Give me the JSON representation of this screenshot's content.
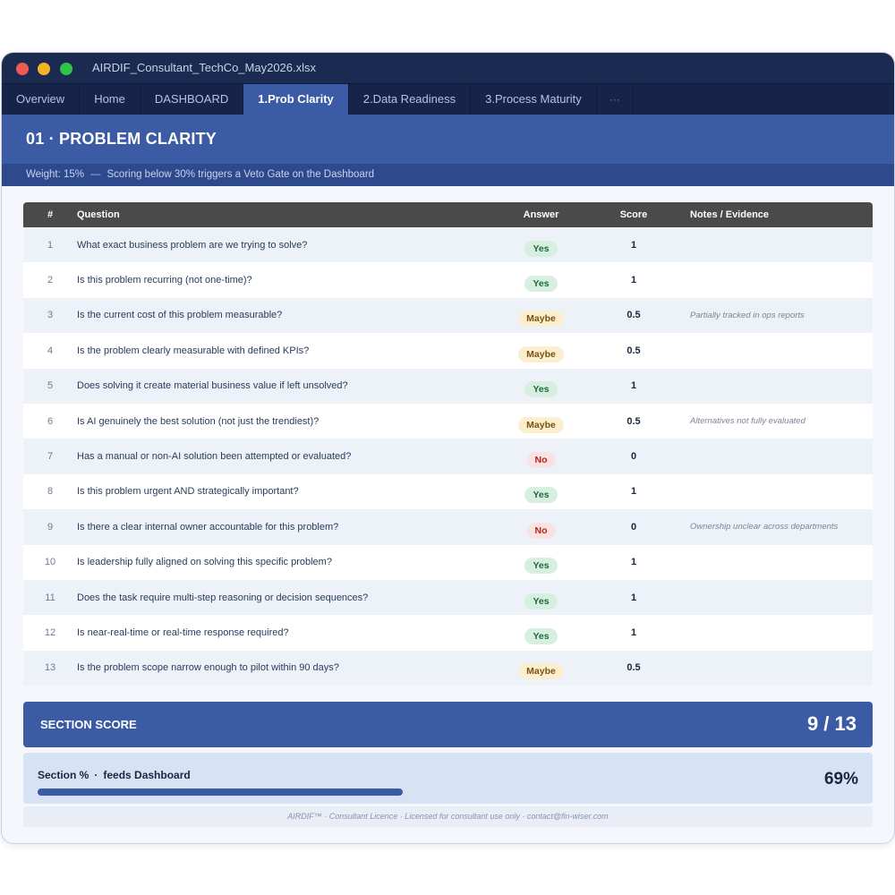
{
  "window": {
    "title": "AIRDIF_Consultant_TechCo_May2026.xlsx"
  },
  "tabs": [
    {
      "label": "Overview",
      "active": false
    },
    {
      "label": "Home",
      "active": false
    },
    {
      "label": "DASHBOARD",
      "active": false
    },
    {
      "label": "1.Prob Clarity",
      "active": true
    },
    {
      "label": "2.Data Readiness",
      "active": false
    },
    {
      "label": "3.Process Maturity",
      "active": false
    },
    {
      "label": "···",
      "active": false
    }
  ],
  "section": {
    "title": "01 · PROBLEM CLARITY",
    "weight": "Weight: 15%",
    "dash": "—",
    "weight_note": "Scoring below 30% triggers a Veto Gate on the Dashboard"
  },
  "table": {
    "headers": {
      "num": "#",
      "question": "Question",
      "answer": "Answer",
      "score": "Score",
      "notes": "Notes / Evidence"
    },
    "rows": [
      {
        "num": "1",
        "question": "What exact business problem are we trying to solve?",
        "answer": "Yes",
        "score": "1",
        "notes": ""
      },
      {
        "num": "2",
        "question": "Is this problem recurring (not one-time)?",
        "answer": "Yes",
        "score": "1",
        "notes": ""
      },
      {
        "num": "3",
        "question": "Is the current cost of this problem measurable?",
        "answer": "Maybe",
        "score": "0.5",
        "notes": "Partially tracked in ops reports"
      },
      {
        "num": "4",
        "question": "Is the problem clearly measurable with defined KPIs?",
        "answer": "Maybe",
        "score": "0.5",
        "notes": ""
      },
      {
        "num": "5",
        "question": "Does solving it create material business value if left unsolved?",
        "answer": "Yes",
        "score": "1",
        "notes": ""
      },
      {
        "num": "6",
        "question": "Is AI genuinely the best solution (not just the trendiest)?",
        "answer": "Maybe",
        "score": "0.5",
        "notes": "Alternatives not fully evaluated"
      },
      {
        "num": "7",
        "question": "Has a manual or non-AI solution been attempted or evaluated?",
        "answer": "No",
        "score": "0",
        "notes": ""
      },
      {
        "num": "8",
        "question": "Is this problem urgent AND strategically important?",
        "answer": "Yes",
        "score": "1",
        "notes": ""
      },
      {
        "num": "9",
        "question": "Is there a clear internal owner accountable for this problem?",
        "answer": "No",
        "score": "0",
        "notes": "Ownership unclear across departments"
      },
      {
        "num": "10",
        "question": "Is leadership fully aligned on solving this specific problem?",
        "answer": "Yes",
        "score": "1",
        "notes": ""
      },
      {
        "num": "11",
        "question": "Does the task require multi-step reasoning or decision sequences?",
        "answer": "Yes",
        "score": "1",
        "notes": ""
      },
      {
        "num": "12",
        "question": "Is near-real-time or real-time response required?",
        "answer": "Yes",
        "score": "1",
        "notes": ""
      },
      {
        "num": "13",
        "question": "Is the problem scope narrow enough to pilot within 90 days?",
        "answer": "Maybe",
        "score": "0.5",
        "notes": ""
      }
    ]
  },
  "summary": {
    "score_label": "SECTION SCORE",
    "score_value": "9 / 13",
    "pct_label": "Section %",
    "pct_sep": "·",
    "pct_suffix": "feeds Dashboard",
    "pct_value": "69%",
    "pct_fraction": 0.69
  },
  "footer": {
    "text": "AIRDIF™  ·  Consultant Licence  ·  Licensed for consultant use only  ·  contact@fin-wiser.com"
  },
  "colors": {
    "navy": "#1a2a50",
    "accent": "#3b5ba5",
    "yes": "#1e6b3b",
    "maybe": "#7a5310",
    "no": "#b3261e"
  }
}
